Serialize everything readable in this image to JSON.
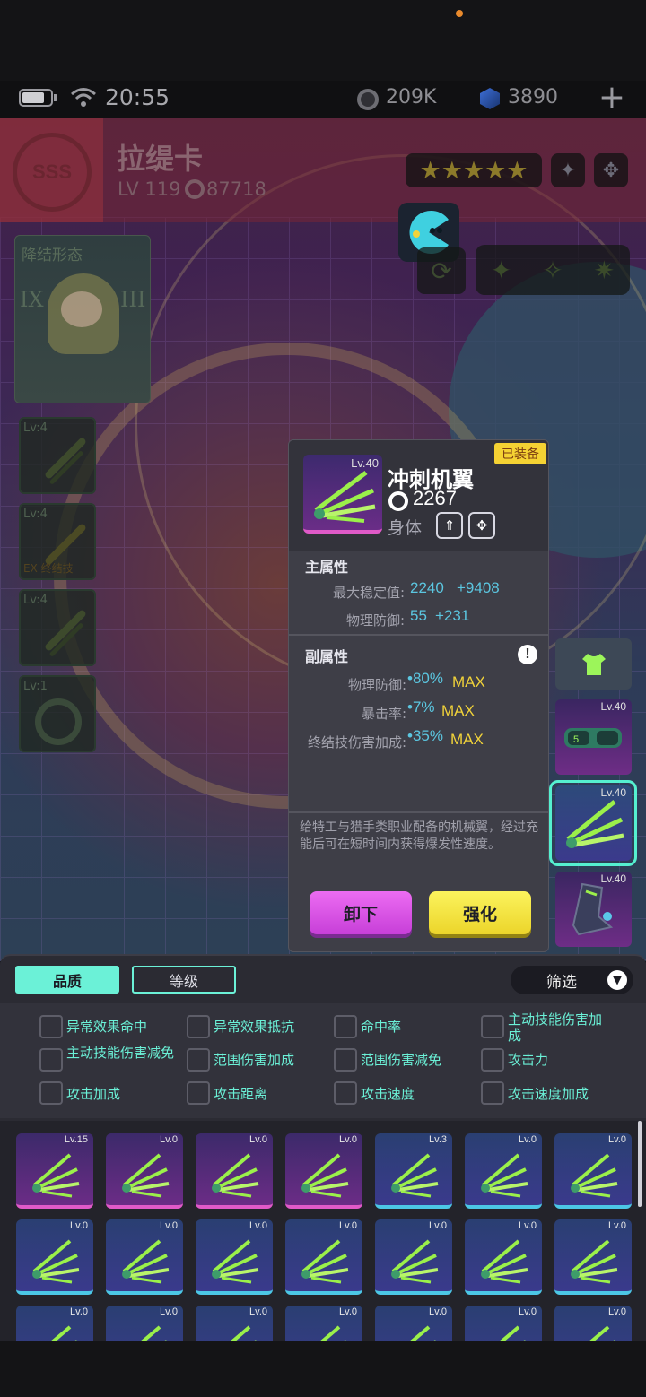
{
  "status_bar": {
    "time": "20:55",
    "coins": "209K",
    "gems": "3890",
    "add_icon": "plus-icon"
  },
  "character": {
    "rank": "SSS",
    "name": "拉缇卡",
    "level": "LV 119",
    "power": "87718",
    "stars": "★★★★★",
    "portrait_label": "降结形态"
  },
  "skill_slots": [
    "✦",
    "✧",
    "✷"
  ],
  "side_slots": [
    {
      "level": "Lv:4",
      "tag": ""
    },
    {
      "level": "Lv:4",
      "tag": "EX 终结技"
    },
    {
      "level": "Lv:4",
      "tag": ""
    },
    {
      "level": "Lv:1",
      "tag": ""
    }
  ],
  "detail": {
    "equipped_badge": "已装备",
    "icon_level": "Lv.40",
    "name": "冲刺机翼",
    "power": "2267",
    "slot": "身体",
    "main_title": "主属性",
    "main_stats": [
      {
        "name": "最大稳定值:",
        "base": "2240",
        "bonus": "+9408"
      },
      {
        "name": "物理防御:",
        "base": "55",
        "bonus": "+231"
      }
    ],
    "sub_title": "副属性",
    "sub_stats": [
      {
        "name": "物理防御:",
        "value": "•80%",
        "max": "MAX"
      },
      {
        "name": "暴击率:",
        "value": "•7%",
        "max": "MAX"
      },
      {
        "name": "终结技伤害加成:",
        "value": "•35%",
        "max": "MAX"
      }
    ],
    "description": "给特工与猎手类职业配备的机械翼，经过充能后可在短时间内获得爆发性速度。",
    "unequip_label": "卸下",
    "enhance_label": "强化"
  },
  "right_slots": [
    {
      "level": "Lv.40"
    },
    {
      "level": "Lv.40"
    },
    {
      "level": "Lv.40"
    }
  ],
  "tabs": {
    "quality": "品质",
    "level": "等级",
    "filter": "筛选"
  },
  "filters": [
    "异常效果命中",
    "异常效果抵抗",
    "命中率",
    "主动技能伤害加成",
    "主动技能伤害减免",
    "范围伤害加成",
    "范围伤害减免",
    "攻击力",
    "攻击加成",
    "攻击距离",
    "攻击速度",
    "攻击速度加成"
  ],
  "inventory": [
    {
      "level": "Lv.15",
      "rarity": "purple"
    },
    {
      "level": "Lv.0",
      "rarity": "purple"
    },
    {
      "level": "Lv.0",
      "rarity": "purple"
    },
    {
      "level": "Lv.0",
      "rarity": "purple"
    },
    {
      "level": "Lv.3",
      "rarity": "blue"
    },
    {
      "level": "Lv.0",
      "rarity": "blue"
    },
    {
      "level": "Lv.0",
      "rarity": "blue"
    },
    {
      "level": "Lv.0",
      "rarity": "blue"
    },
    {
      "level": "Lv.0",
      "rarity": "blue"
    },
    {
      "level": "Lv.0",
      "rarity": "blue"
    },
    {
      "level": "Lv.0",
      "rarity": "blue"
    },
    {
      "level": "Lv.0",
      "rarity": "blue"
    },
    {
      "level": "Lv.0",
      "rarity": "blue"
    },
    {
      "level": "Lv.0",
      "rarity": "blue"
    },
    {
      "level": "Lv.0",
      "rarity": "blue"
    },
    {
      "level": "Lv.0",
      "rarity": "blue"
    },
    {
      "level": "Lv.0",
      "rarity": "blue"
    },
    {
      "level": "Lv.0",
      "rarity": "blue"
    },
    {
      "level": "Lv.0",
      "rarity": "blue"
    },
    {
      "level": "Lv.0",
      "rarity": "blue"
    },
    {
      "level": "Lv.0",
      "rarity": "blue"
    }
  ],
  "colors": {
    "accent": "#6bf1d7",
    "purple_rarity": "#e05ac8",
    "blue_rarity": "#4cc7e6",
    "max": "#f0d23a",
    "stat_value": "#5bc6e0"
  }
}
